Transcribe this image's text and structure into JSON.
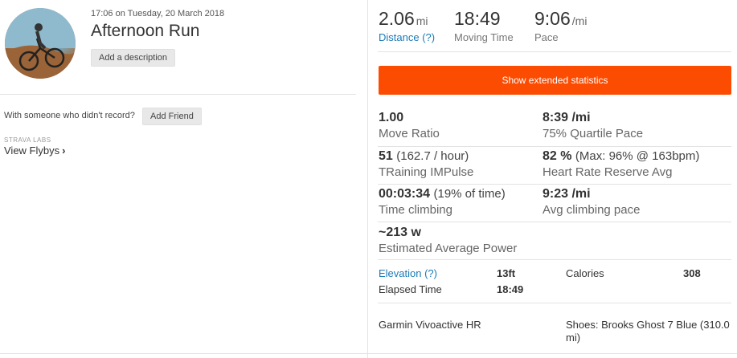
{
  "activity": {
    "datetime": "17:06 on Tuesday, 20 March 2018",
    "title": "Afternoon Run",
    "add_description": "Add a description",
    "someone_text": "With someone who didn't record?",
    "add_friend": "Add Friend",
    "labs_label": "STRAVA LABS",
    "view_flybys": "View Flybys"
  },
  "summary": {
    "distance": {
      "value": "2.06",
      "unit": "mi",
      "label": "Distance (?)"
    },
    "moving_time": {
      "value": "18:49",
      "label": "Moving Time"
    },
    "pace": {
      "value": "9:06",
      "unit": "/mi",
      "label": "Pace"
    }
  },
  "extended_button": "Show extended statistics",
  "stats": {
    "move_ratio": {
      "value": "1.00",
      "label": "Move Ratio"
    },
    "quartile_pace": {
      "value": "8:39 /mi",
      "label": "75% Quartile Pace"
    },
    "training": {
      "value": "51",
      "sub": "(162.7 / hour)",
      "label": "TRaining IMPulse"
    },
    "hrr": {
      "value": "82 %",
      "sub": "(Max: 96% @ 163bpm)",
      "label": "Heart Rate Reserve Avg"
    },
    "climbing": {
      "value": "00:03:34",
      "sub": "(19% of time)",
      "label": "Time climbing"
    },
    "climb_pace": {
      "value": "9:23 /mi",
      "label": "Avg climbing pace"
    },
    "power": {
      "value": "~213 w",
      "label": "Estimated Average Power"
    }
  },
  "details": {
    "elevation_label": "Elevation (?)",
    "elevation_value": "13ft",
    "calories_label": "Calories",
    "calories_value": "308",
    "elapsed_label": "Elapsed Time",
    "elapsed_value": "18:49",
    "device": "Garmin Vivoactive HR",
    "shoes": "Shoes: Brooks Ghost 7 Blue (310.0 mi)"
  },
  "colors": {
    "accent": "#fc4c02",
    "link": "#1a7ab8"
  }
}
